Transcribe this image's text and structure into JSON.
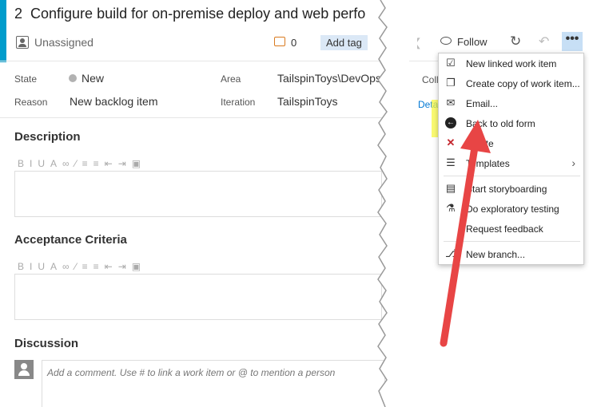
{
  "work_item": {
    "id": "2",
    "title": "Configure build for on-premise deploy and web perfo",
    "assignee": "Unassigned",
    "comment_count": "0",
    "add_tag_label": "Add tag"
  },
  "toolbar": {
    "follow_label": "Follow",
    "more_label": "•••"
  },
  "fields": {
    "state_label": "State",
    "state_value": "New",
    "area_label": "Area",
    "area_value": "TailspinToys\\DevOps",
    "reason_label": "Reason",
    "reason_value": "New backlog item",
    "iteration_label": "Iteration",
    "iteration_value": "TailspinToys"
  },
  "sections": {
    "description_title": "Description",
    "acceptance_title": "Acceptance Criteria",
    "discussion_title": "Discussion",
    "comment_placeholder": "Add a comment. Use # to link a work item or @ to mention a person"
  },
  "right_fragments": {
    "col": "Coll",
    "details": "Deta"
  },
  "menu": {
    "items": [
      {
        "label": "New linked work item",
        "icon": "link-work-item-icon"
      },
      {
        "label": "Create copy of work item...",
        "icon": "copy-icon"
      },
      {
        "label": "Email...",
        "icon": "email-icon"
      },
      {
        "label": "Back to old form",
        "icon": "back-arrow-icon"
      },
      {
        "label": "Delete",
        "icon": "delete-icon"
      },
      {
        "label": "Templates",
        "icon": "templates-icon"
      },
      {
        "label": "Start storyboarding",
        "icon": "storyboard-icon"
      },
      {
        "label": "Do exploratory testing",
        "icon": "flask-icon"
      },
      {
        "label": "Request feedback",
        "icon": "feedback-icon"
      },
      {
        "label": "New branch...",
        "icon": "branch-icon"
      }
    ]
  },
  "colors": {
    "accent_bar": "#009ccc",
    "highlight": "#f8f83c",
    "arrow": "#e84545",
    "delete_red": "#c4262e"
  }
}
